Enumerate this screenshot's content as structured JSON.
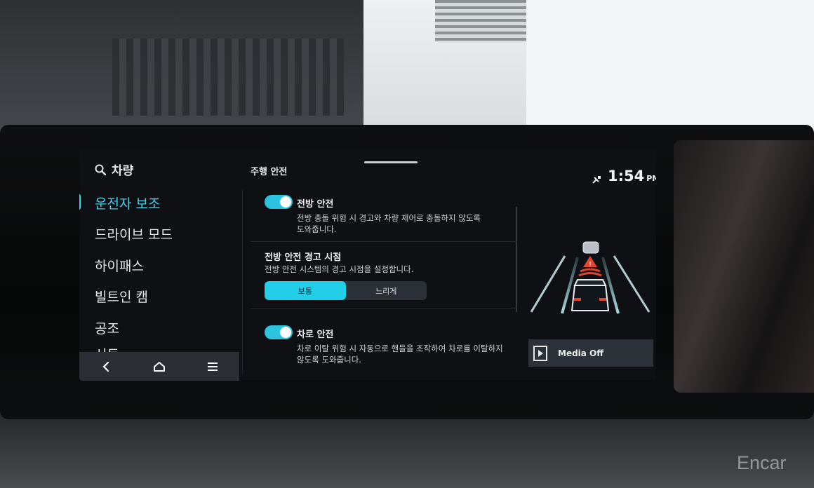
{
  "sidebar": {
    "search_label": "차량",
    "items": [
      {
        "label": "운전자 보조",
        "active": true
      },
      {
        "label": "드라이브 모드",
        "active": false
      },
      {
        "label": "하이패스",
        "active": false
      },
      {
        "label": "빌트인 캠",
        "active": false
      },
      {
        "label": "공조",
        "active": false
      },
      {
        "label": "시트",
        "active": false
      }
    ]
  },
  "bottom_bar": {
    "icons": [
      "back-icon",
      "home-icon",
      "menu-icon"
    ]
  },
  "content": {
    "title": "주행 안전",
    "forward_safety": {
      "title": "전방 안전",
      "desc": "전방 충돌 위험 시 경고와 차량 제어로 충돌하지 않도록 도와줍니다.",
      "enabled": true
    },
    "warning_timing": {
      "title": "전방 안전 경고 시점",
      "desc": "전방 안전 시스템의 경고 시점을 설정합니다.",
      "options": [
        "보통",
        "느리게"
      ],
      "selected": "보통"
    },
    "lane_safety": {
      "title": "차로 안전",
      "desc": "차로 이탈 위험 시 자동으로 핸들을 조작하여 차로를 이탈하지 않도록 도와줍니다.",
      "enabled": true
    }
  },
  "status": {
    "time": "1:54",
    "ampm": "PM"
  },
  "media": {
    "label": "Media Off"
  },
  "watermark": "Encar",
  "colors": {
    "accent": "#3fd3ec",
    "toggle": "#2bc3dd",
    "screen_bg": "#0e1013"
  }
}
